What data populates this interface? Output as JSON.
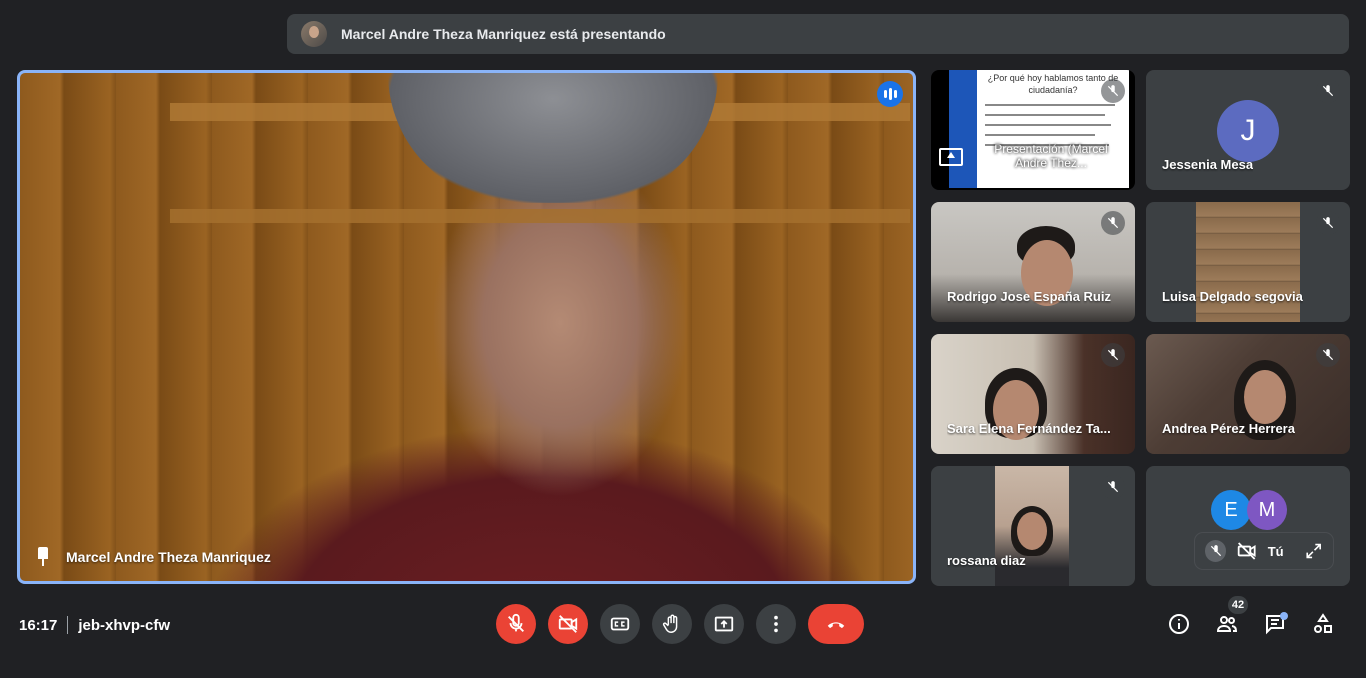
{
  "banner": {
    "text": "Marcel Andre Theza Manriquez está presentando"
  },
  "main_tile": {
    "name": "Marcel Andre Theza Manriquez"
  },
  "tiles": {
    "presentation": {
      "label": "Presentación (Marcel Andre Thez...",
      "slide_title": "¿Por qué hoy hablamos tanto de ciudadanía?"
    },
    "jessenia": {
      "name": "Jessenia Mesa",
      "initial": "J",
      "color": "#5c6bc0"
    },
    "rodrigo": {
      "name": "Rodrigo Jose España Ruiz"
    },
    "luisa": {
      "name": "Luisa Delgado segovia"
    },
    "sara": {
      "name": "Sara Elena Fernández Ta..."
    },
    "andrea": {
      "name": "Andrea Pérez Herrera"
    },
    "rossana": {
      "name": "rossana diaz"
    },
    "self": {
      "initial_1": "E",
      "color_1": "#1e88e5",
      "initial_2": "M",
      "color_2": "#7e57c2",
      "label": "Tú"
    }
  },
  "bottom_bar": {
    "time": "16:17",
    "meeting_code": "jeb-xhvp-cfw",
    "participants_count": "42"
  },
  "colors": {
    "accent": "#8ab4f8",
    "danger": "#ea4335",
    "surface": "#3c4043",
    "background": "#202124"
  }
}
